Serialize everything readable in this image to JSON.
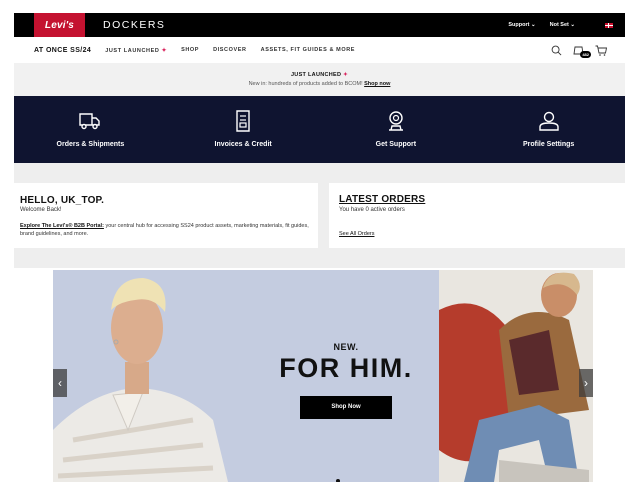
{
  "topbar": {
    "brand1": "Levi's",
    "brand2": "DOCKERS",
    "support": "Support",
    "account": "Not Set"
  },
  "nav": {
    "items": [
      "AT ONCE SS/24",
      "JUST LAUNCHED",
      "SHOP",
      "DISCOVER",
      "ASSETS, FIT GUIDES & MORE"
    ],
    "cart_count": "482"
  },
  "announce": {
    "title": "JUST LAUNCHED",
    "text": "New in: hundreds of products added to BCOM!",
    "link": "Shop now"
  },
  "tiles": [
    {
      "label": "Orders & Shipments",
      "icon": "truck-icon"
    },
    {
      "label": "Invoices & Credit",
      "icon": "invoice-icon"
    },
    {
      "label": "Get Support",
      "icon": "support-icon"
    },
    {
      "label": "Profile Settings",
      "icon": "user-icon"
    }
  ],
  "welcome": {
    "hello": "HELLO, UK_TOP.",
    "sub": "Welcome Back!",
    "link": "Explore The Levi's® B2B Portal:",
    "desc": "your central hub for accessing SS24 product assets, marketing materials, fit guides, brand guidelines, and more."
  },
  "orders": {
    "title": "LATEST ORDERS",
    "status": "You have 0 active orders",
    "link": "See All Orders"
  },
  "hero": {
    "kicker": "NEW.",
    "headline": "FOR HIM.",
    "cta": "Shop Now"
  },
  "colors": {
    "brand_red": "#c41230",
    "navy": "#0f1430",
    "hero_bg": "#c4cce0"
  }
}
